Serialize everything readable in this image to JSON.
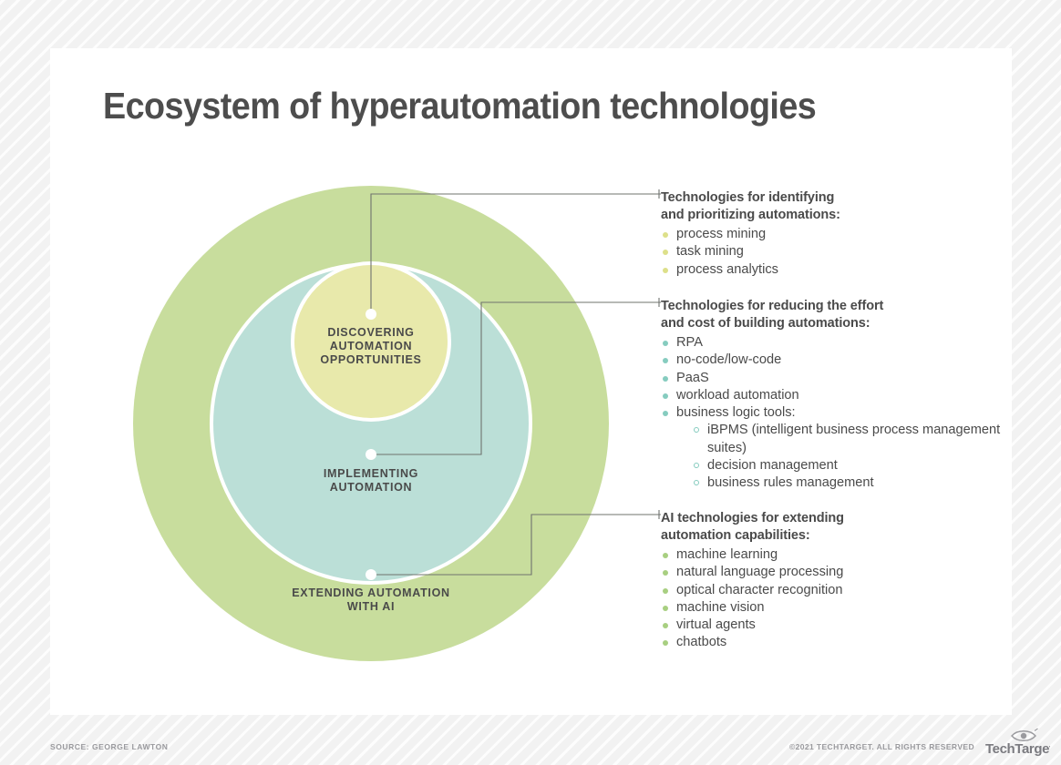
{
  "title": "Ecosystem of hyperautomation technologies",
  "colors": {
    "outer_ring": "#c8dd9d",
    "middle_ring": "#bbdfd7",
    "inner_circle": "#e8e9ab",
    "bullet_yellow": "#dde08a",
    "bullet_teal": "#86ccbf",
    "bullet_green": "#a8cf81",
    "connector": "#6f736e",
    "text": "#4a4a4a",
    "card": "#ffffff",
    "page_background": "#f4f4f4"
  },
  "diagram": {
    "rings": [
      {
        "id": "inner",
        "label": "DISCOVERING\nAUTOMATION\nOPPORTUNITIES",
        "label_lines": [
          "DISCOVERING",
          "AUTOMATION",
          "OPPORTUNITIES"
        ]
      },
      {
        "id": "middle",
        "label": "IMPLEMENTING\nAUTOMATION",
        "label_lines": [
          "IMPLEMENTING",
          "AUTOMATION"
        ]
      },
      {
        "id": "outer",
        "label": "EXTENDING AUTOMATION\nWITH AI",
        "label_lines": [
          "EXTENDING AUTOMATION",
          "WITH AI"
        ]
      }
    ],
    "label_inner_l1": "DISCOVERING",
    "label_inner_l2": "AUTOMATION",
    "label_inner_l3": "OPPORTUNITIES",
    "label_middle_l1": "IMPLEMENTING",
    "label_middle_l2": "AUTOMATION",
    "label_outer_l1": "EXTENDING AUTOMATION",
    "label_outer_l2": "WITH AI"
  },
  "blocks": [
    {
      "heading_l1": "Technologies for identifying",
      "heading_l2": "and prioritizing automations:",
      "bullet_color": "#dde08a",
      "items": [
        {
          "text": "process mining"
        },
        {
          "text": "task mining"
        },
        {
          "text": "process analytics"
        }
      ]
    },
    {
      "heading_l1": "Technologies for reducing the effort",
      "heading_l2": "and cost of building automations:",
      "bullet_color": "#86ccbf",
      "items": [
        {
          "text": "RPA"
        },
        {
          "text": "no-code/low-code"
        },
        {
          "text": "PaaS"
        },
        {
          "text": "workload automation"
        },
        {
          "text": "business logic tools:",
          "sub": [
            {
              "text": "iBPMS (intelligent business process management suites)"
            },
            {
              "text": "decision management"
            },
            {
              "text": "business rules management"
            }
          ]
        }
      ]
    },
    {
      "heading_l1": "AI technologies for extending",
      "heading_l2": "automation capabilities:",
      "bullet_color": "#a8cf81",
      "items": [
        {
          "text": "machine learning"
        },
        {
          "text": "natural language processing"
        },
        {
          "text": "optical character recognition"
        },
        {
          "text": "machine vision"
        },
        {
          "text": "virtual agents"
        },
        {
          "text": "chatbots"
        }
      ]
    }
  ],
  "footer": {
    "source": "SOURCE: GEORGE LAWTON",
    "copyright": "©2021 TECHTARGET. ALL RIGHTS RESERVED",
    "logo_text": "TechTarget"
  }
}
